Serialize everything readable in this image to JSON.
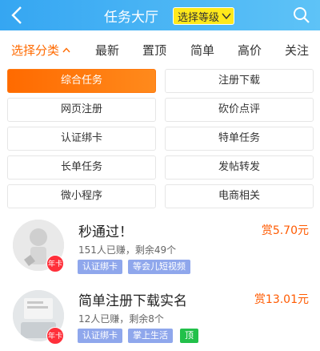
{
  "header": {
    "title": "任务大厅",
    "level_label": "选择等级"
  },
  "filters": [
    {
      "label": "选择分类",
      "active": true
    },
    {
      "label": "最新"
    },
    {
      "label": "置顶"
    },
    {
      "label": "简单"
    },
    {
      "label": "高价"
    },
    {
      "label": "关注"
    }
  ],
  "categories": [
    {
      "label": "综合任务",
      "selected": true
    },
    {
      "label": "注册下载"
    },
    {
      "label": "网页注册"
    },
    {
      "label": "砍价点评"
    },
    {
      "label": "认证绑卡"
    },
    {
      "label": "特单任务"
    },
    {
      "label": "长单任务"
    },
    {
      "label": "发帖转发"
    },
    {
      "label": "微小程序"
    },
    {
      "label": "电商相关"
    }
  ],
  "tasks": [
    {
      "title": "秒通过！",
      "reward": "赏5.70元",
      "meta": "151人已赚，剩余49个",
      "badge": "年卡",
      "tags": [
        "认证绑卡",
        "等会儿短视频"
      ]
    },
    {
      "title": "简单注册下载实名",
      "reward": "赏13.01元",
      "meta": "12人已赚，剩余8个",
      "badge": "年卡",
      "tags": [
        "认证绑卡",
        "掌上生活",
        "顶"
      ]
    }
  ],
  "colors": {
    "header": "#35a6f2",
    "accent": "#ff6a00",
    "tag": "#8fa7ec",
    "top_tag": "#22c04a"
  }
}
